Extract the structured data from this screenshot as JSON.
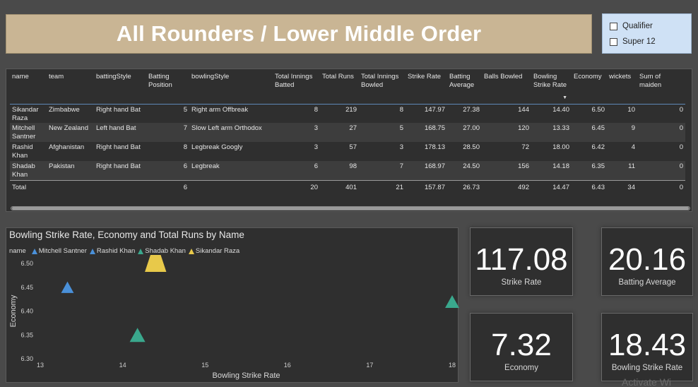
{
  "header": {
    "title": "All Rounders / Lower Middle Order"
  },
  "slicer": {
    "options": [
      {
        "label": "Qualifier"
      },
      {
        "label": "Super 12"
      }
    ]
  },
  "table": {
    "headers": {
      "name": "name",
      "team": "team",
      "battingStyle": "battingStyle",
      "battingPosition": "Batting Position",
      "bowlingStyle": "bowlingStyle",
      "inningsBatted": "Total Innings Batted",
      "totalRuns": "Total Runs",
      "inningsBowled": "Total Innings Bowled",
      "strikeRate": "Strike Rate",
      "battingAverage": "Batting Average",
      "ballsBowled": "Balls Bowled",
      "bowlingStrikeRate": "Bowling Strike Rate",
      "economy": "Economy",
      "wickets": "wickets",
      "maidens": "Sum of maiden"
    },
    "rows": [
      {
        "name": "Sikandar Raza",
        "team": "Zimbabwe",
        "battingStyle": "Right hand Bat",
        "battingPosition": "5",
        "bowlingStyle": "Right arm Offbreak",
        "inningsBatted": "8",
        "totalRuns": "219",
        "inningsBowled": "8",
        "strikeRate": "147.97",
        "battingAverage": "27.38",
        "ballsBowled": "144",
        "bowlingStrikeRate": "14.40",
        "economy": "6.50",
        "wickets": "10",
        "maidens": "0"
      },
      {
        "name": "Mitchell Santner",
        "team": "New Zealand",
        "battingStyle": "Left hand Bat",
        "battingPosition": "7",
        "bowlingStyle": "Slow Left arm Orthodox",
        "inningsBatted": "3",
        "totalRuns": "27",
        "inningsBowled": "5",
        "strikeRate": "168.75",
        "battingAverage": "27.00",
        "ballsBowled": "120",
        "bowlingStrikeRate": "13.33",
        "economy": "6.45",
        "wickets": "9",
        "maidens": "0"
      },
      {
        "name": "Rashid Khan",
        "team": "Afghanistan",
        "battingStyle": "Right hand Bat",
        "battingPosition": "8",
        "bowlingStyle": "Legbreak Googly",
        "inningsBatted": "3",
        "totalRuns": "57",
        "inningsBowled": "3",
        "strikeRate": "178.13",
        "battingAverage": "28.50",
        "ballsBowled": "72",
        "bowlingStrikeRate": "18.00",
        "economy": "6.42",
        "wickets": "4",
        "maidens": "0"
      },
      {
        "name": "Shadab Khan",
        "team": "Pakistan",
        "battingStyle": "Right hand Bat",
        "battingPosition": "6",
        "bowlingStyle": "Legbreak",
        "inningsBatted": "6",
        "totalRuns": "98",
        "inningsBowled": "7",
        "strikeRate": "168.97",
        "battingAverage": "24.50",
        "ballsBowled": "156",
        "bowlingStrikeRate": "14.18",
        "economy": "6.35",
        "wickets": "11",
        "maidens": "0"
      }
    ],
    "total": {
      "name": "Total",
      "team": "",
      "battingStyle": "",
      "battingPosition": "6",
      "bowlingStyle": "",
      "inningsBatted": "20",
      "totalRuns": "401",
      "inningsBowled": "21",
      "strikeRate": "157.87",
      "battingAverage": "26.73",
      "ballsBowled": "492",
      "bowlingStrikeRate": "14.47",
      "economy": "6.43",
      "wickets": "34",
      "maidens": "0"
    }
  },
  "chart_data": {
    "type": "scatter",
    "title": "Bowling Strike Rate, Economy and Total Runs by Name",
    "xlabel": "Bowling Strike Rate",
    "ylabel": "Economy",
    "legend_title": "name",
    "legend_position": "top-left",
    "xlim": [
      13,
      18
    ],
    "ylim": [
      6.3,
      6.5
    ],
    "x_ticks": [
      "13",
      "14",
      "15",
      "16",
      "17",
      "18"
    ],
    "y_ticks": [
      "6.30",
      "6.35",
      "6.40",
      "6.45",
      "6.50"
    ],
    "size_by": "Total Runs",
    "series": [
      {
        "name": "Mitchell Santner",
        "color": "#4a90d9",
        "x": 13.33,
        "y": 6.45,
        "size": 27
      },
      {
        "name": "Rashid Khan",
        "color": "#3aa88d",
        "x": 18.0,
        "y": 6.42,
        "size": 57
      },
      {
        "name": "Shadab Khan",
        "color": "#3aa88d",
        "x": 14.18,
        "y": 6.35,
        "size": 98
      },
      {
        "name": "Sikandar Raza",
        "color": "#e8c94a",
        "x": 14.4,
        "y": 6.5,
        "size": 219
      }
    ]
  },
  "cards": [
    {
      "value": "117.08",
      "label": "Strike Rate"
    },
    {
      "value": "20.16",
      "label": "Batting Average"
    },
    {
      "value": "7.32",
      "label": "Economy"
    },
    {
      "value": "18.43",
      "label": "Bowling Strike Rate"
    }
  ],
  "watermark": "Activate Wi"
}
